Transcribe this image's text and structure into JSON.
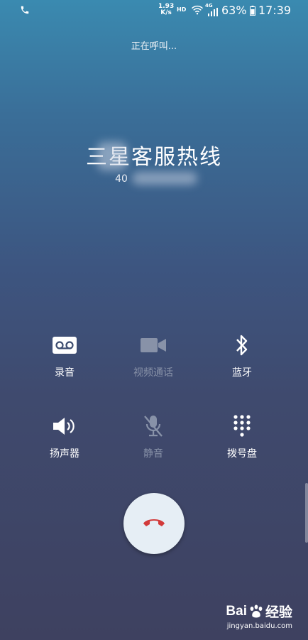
{
  "status_bar": {
    "net_speed_value": "1.93",
    "net_speed_unit": "K/s",
    "hd": "HD",
    "network": "4G",
    "battery": "63%",
    "time": "17:39"
  },
  "call": {
    "status": "正在呼叫...",
    "contact_name": "三星客服热线",
    "contact_number": "40"
  },
  "controls": {
    "row1": [
      {
        "label": "录音",
        "icon": "voicemail-icon"
      },
      {
        "label": "视频通话",
        "icon": "video-camera-icon"
      },
      {
        "label": "蓝牙",
        "icon": "bluetooth-icon"
      }
    ],
    "row2": [
      {
        "label": "扬声器",
        "icon": "speaker-icon"
      },
      {
        "label": "静音",
        "icon": "mute-mic-icon"
      },
      {
        "label": "拨号盘",
        "icon": "dialpad-icon"
      }
    ]
  },
  "watermark": {
    "logo_left": "Bai",
    "logo_right": "经验",
    "url": "jingyan.baidu.com"
  },
  "colors": {
    "end_call_icon": "#d23a3a",
    "end_call_bg": "#e6eef5"
  }
}
